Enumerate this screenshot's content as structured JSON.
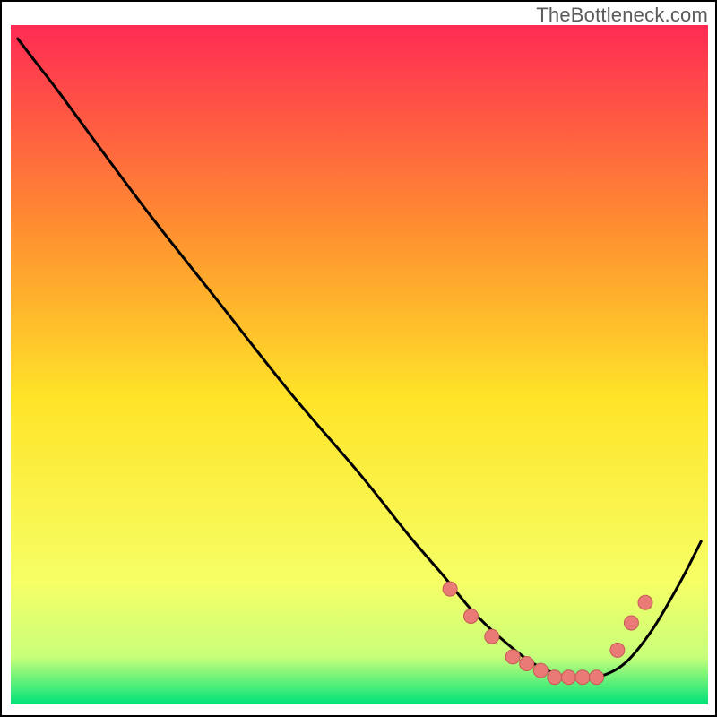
{
  "watermark": "TheBottleneck.com",
  "colors": {
    "grad_top": "#ff2b54",
    "grad_q1": "#ff8f30",
    "grad_mid": "#ffe428",
    "grad_q3": "#f6ff66",
    "grad_low": "#c8ff7a",
    "grad_bottom": "#00e27a",
    "line": "#000000",
    "marker_fill": "#e97a76",
    "marker_stroke": "#c55a56",
    "border": "#000000"
  },
  "chart_data": {
    "type": "line",
    "title": "",
    "xlabel": "",
    "ylabel": "",
    "xlim": [
      0,
      100
    ],
    "ylim": [
      0,
      100
    ],
    "note": "Axes are unlabeled in the source image; values below are estimated as percent of plot width/height, where y=0 is the top of the gradient area and y=100 is the bottom.",
    "series": [
      {
        "name": "curve",
        "x": [
          1,
          4,
          7,
          12,
          20,
          30,
          40,
          50,
          57,
          62,
          66,
          70,
          75,
          80,
          84,
          88,
          92,
          96,
          99
        ],
        "y": [
          2,
          6,
          10,
          17,
          28,
          41,
          54,
          66,
          75,
          81,
          86,
          90,
          94,
          96,
          96,
          94,
          89,
          82,
          76
        ]
      }
    ],
    "markers": {
      "name": "trough-markers",
      "x": [
        63,
        66,
        69,
        72,
        74,
        76,
        78,
        80,
        82,
        84,
        87,
        89,
        91
      ],
      "y": [
        83,
        87,
        90,
        93,
        94,
        95,
        96,
        96,
        96,
        96,
        92,
        88,
        85
      ]
    }
  }
}
